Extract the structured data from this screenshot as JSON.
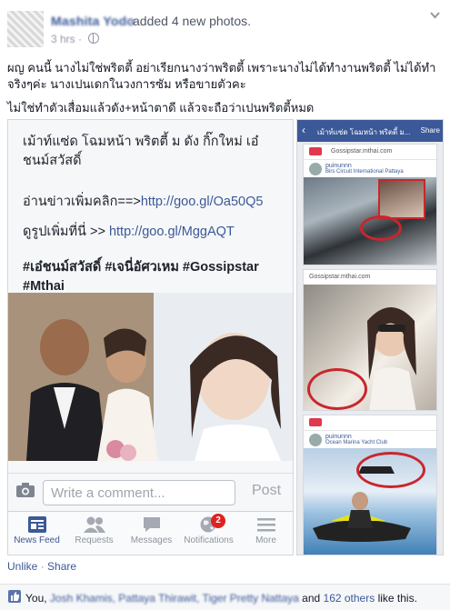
{
  "post": {
    "author": "Mashita Yodo",
    "action": "added 4 new photos.",
    "time": "3 hrs",
    "time_separator": "·",
    "body_line1": "ผญ คนนี้ นางไม่ใช่พริตตี้ อย่าเรียกนางว่าพริตตี้ เพราะนางไม่ได้ทำงานพริตตี้ ไม่ได้ทำจริงๆค่ะ นางเปนเดกในวงการซัม หรือขายตัวคะ",
    "body_line2": "ไม่ใช่ทำตัวเสื่อมแล้วดัง+หน้าตาดี แล้วจะถือว่าเปนพริตตี้หมด"
  },
  "phone": {
    "headline": "เม้าท์แซ่ด โฉมหน้า พริตตี้ ม ดัง กิ๊กใหม่ เอ๋ ชนม์สวัสดิ์",
    "read_more_prefix": "อ่านข่าวเพิ่มคลิก==>",
    "read_more_link": "http://goo.gl/Oa50Q5",
    "more_photos_prefix": "ดูรูปเพิ่มที่นี่ >> ",
    "more_photos_link": "http://goo.gl/MggAQT",
    "tags": "#เอ๋ชนม์สวัสดิ์ #เจนี่อัศวเหม #Gossipstar #Mthai",
    "comment_placeholder": "Write a comment...",
    "post_label": "Post",
    "tabs": [
      {
        "label": "News Feed",
        "icon": "news-feed-icon"
      },
      {
        "label": "Requests",
        "icon": "friend-requests-icon"
      },
      {
        "label": "Messages",
        "icon": "messages-icon"
      },
      {
        "label": "Notifications",
        "icon": "globe-icon",
        "badge": "2"
      },
      {
        "label": "More",
        "icon": "menu-icon"
      }
    ]
  },
  "side_shot": {
    "title": "เม้าท์แซ่ด โฉมหน้า พริตตี้ ม...",
    "share": "Share",
    "site": "Gossipstar.mthai.com",
    "site2": "Gossipstar.mthai.com",
    "user1": "puinunnn",
    "loc1": "Birs Circuit International Pattaya",
    "user2": "puinunnn",
    "loc2": "Ocean Marina Yacht Club"
  },
  "footer": {
    "unlike": "Unlike",
    "separator": "·",
    "share": "Share",
    "likes_prefix": "You, ",
    "likes_names": "Josh Khamis, Pattaya Thirawit, Tiger Pretty Nattaya",
    "likes_and": " and ",
    "likes_others": "162 others",
    "likes_suffix": " like this."
  },
  "colors": {
    "link": "#3b5998",
    "badge": "#e02121",
    "highlight_circle": "#c9262c"
  }
}
